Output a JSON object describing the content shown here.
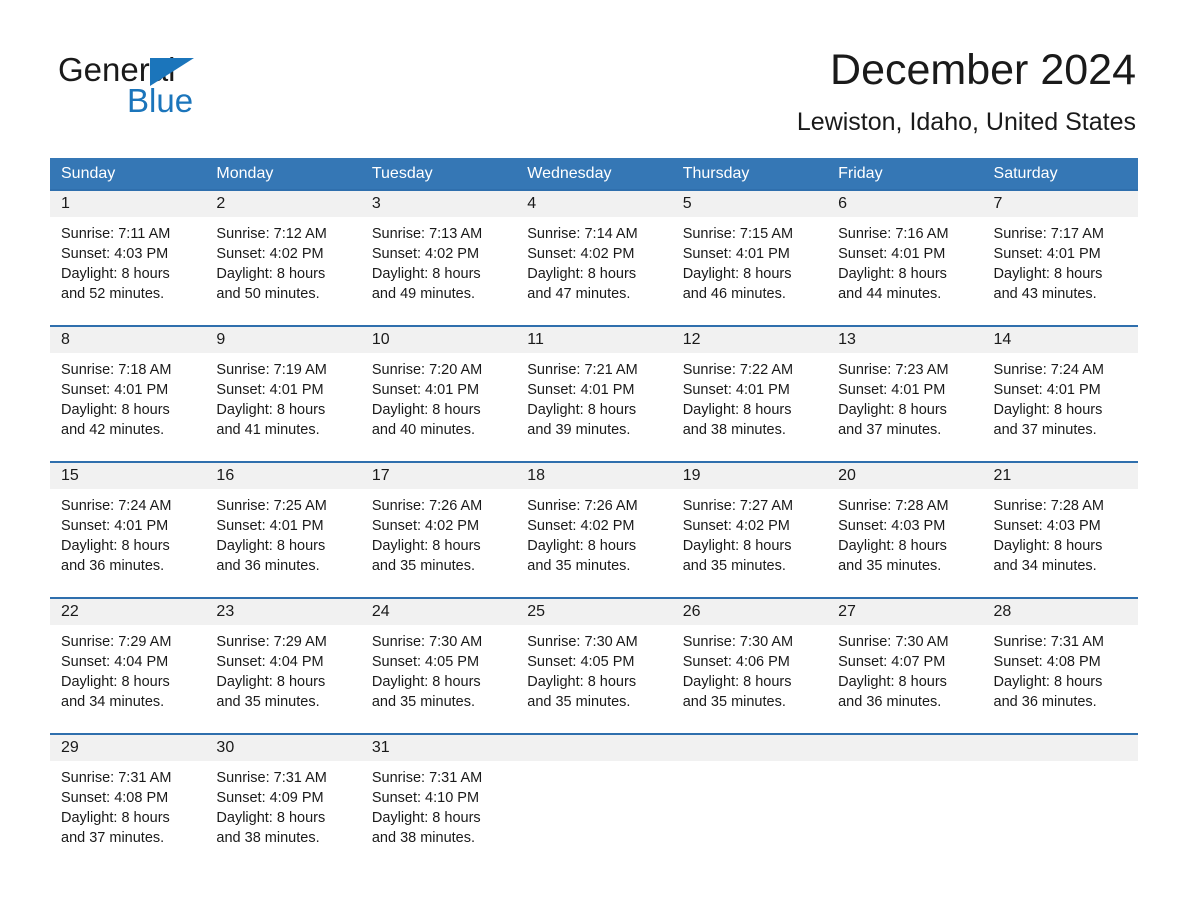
{
  "brand": {
    "name_part1": "General",
    "name_part2": "Blue",
    "accent_color": "#1b75bb"
  },
  "header": {
    "month_title": "December 2024",
    "location": "Lewiston, Idaho, United States"
  },
  "theme": {
    "header_row_bg": "#3577b5",
    "week_rule_color": "#2f6fad",
    "date_band_bg": "#f1f1f1",
    "text_color": "#1a1a1a"
  },
  "weekdays": [
    "Sunday",
    "Monday",
    "Tuesday",
    "Wednesday",
    "Thursday",
    "Friday",
    "Saturday"
  ],
  "weeks": [
    {
      "days": [
        {
          "date": "1",
          "sunrise": "Sunrise: 7:11 AM",
          "sunset": "Sunset: 4:03 PM",
          "daylight_line1": "Daylight: 8 hours",
          "daylight_line2": "and 52 minutes."
        },
        {
          "date": "2",
          "sunrise": "Sunrise: 7:12 AM",
          "sunset": "Sunset: 4:02 PM",
          "daylight_line1": "Daylight: 8 hours",
          "daylight_line2": "and 50 minutes."
        },
        {
          "date": "3",
          "sunrise": "Sunrise: 7:13 AM",
          "sunset": "Sunset: 4:02 PM",
          "daylight_line1": "Daylight: 8 hours",
          "daylight_line2": "and 49 minutes."
        },
        {
          "date": "4",
          "sunrise": "Sunrise: 7:14 AM",
          "sunset": "Sunset: 4:02 PM",
          "daylight_line1": "Daylight: 8 hours",
          "daylight_line2": "and 47 minutes."
        },
        {
          "date": "5",
          "sunrise": "Sunrise: 7:15 AM",
          "sunset": "Sunset: 4:01 PM",
          "daylight_line1": "Daylight: 8 hours",
          "daylight_line2": "and 46 minutes."
        },
        {
          "date": "6",
          "sunrise": "Sunrise: 7:16 AM",
          "sunset": "Sunset: 4:01 PM",
          "daylight_line1": "Daylight: 8 hours",
          "daylight_line2": "and 44 minutes."
        },
        {
          "date": "7",
          "sunrise": "Sunrise: 7:17 AM",
          "sunset": "Sunset: 4:01 PM",
          "daylight_line1": "Daylight: 8 hours",
          "daylight_line2": "and 43 minutes."
        }
      ]
    },
    {
      "days": [
        {
          "date": "8",
          "sunrise": "Sunrise: 7:18 AM",
          "sunset": "Sunset: 4:01 PM",
          "daylight_line1": "Daylight: 8 hours",
          "daylight_line2": "and 42 minutes."
        },
        {
          "date": "9",
          "sunrise": "Sunrise: 7:19 AM",
          "sunset": "Sunset: 4:01 PM",
          "daylight_line1": "Daylight: 8 hours",
          "daylight_line2": "and 41 minutes."
        },
        {
          "date": "10",
          "sunrise": "Sunrise: 7:20 AM",
          "sunset": "Sunset: 4:01 PM",
          "daylight_line1": "Daylight: 8 hours",
          "daylight_line2": "and 40 minutes."
        },
        {
          "date": "11",
          "sunrise": "Sunrise: 7:21 AM",
          "sunset": "Sunset: 4:01 PM",
          "daylight_line1": "Daylight: 8 hours",
          "daylight_line2": "and 39 minutes."
        },
        {
          "date": "12",
          "sunrise": "Sunrise: 7:22 AM",
          "sunset": "Sunset: 4:01 PM",
          "daylight_line1": "Daylight: 8 hours",
          "daylight_line2": "and 38 minutes."
        },
        {
          "date": "13",
          "sunrise": "Sunrise: 7:23 AM",
          "sunset": "Sunset: 4:01 PM",
          "daylight_line1": "Daylight: 8 hours",
          "daylight_line2": "and 37 minutes."
        },
        {
          "date": "14",
          "sunrise": "Sunrise: 7:24 AM",
          "sunset": "Sunset: 4:01 PM",
          "daylight_line1": "Daylight: 8 hours",
          "daylight_line2": "and 37 minutes."
        }
      ]
    },
    {
      "days": [
        {
          "date": "15",
          "sunrise": "Sunrise: 7:24 AM",
          "sunset": "Sunset: 4:01 PM",
          "daylight_line1": "Daylight: 8 hours",
          "daylight_line2": "and 36 minutes."
        },
        {
          "date": "16",
          "sunrise": "Sunrise: 7:25 AM",
          "sunset": "Sunset: 4:01 PM",
          "daylight_line1": "Daylight: 8 hours",
          "daylight_line2": "and 36 minutes."
        },
        {
          "date": "17",
          "sunrise": "Sunrise: 7:26 AM",
          "sunset": "Sunset: 4:02 PM",
          "daylight_line1": "Daylight: 8 hours",
          "daylight_line2": "and 35 minutes."
        },
        {
          "date": "18",
          "sunrise": "Sunrise: 7:26 AM",
          "sunset": "Sunset: 4:02 PM",
          "daylight_line1": "Daylight: 8 hours",
          "daylight_line2": "and 35 minutes."
        },
        {
          "date": "19",
          "sunrise": "Sunrise: 7:27 AM",
          "sunset": "Sunset: 4:02 PM",
          "daylight_line1": "Daylight: 8 hours",
          "daylight_line2": "and 35 minutes."
        },
        {
          "date": "20",
          "sunrise": "Sunrise: 7:28 AM",
          "sunset": "Sunset: 4:03 PM",
          "daylight_line1": "Daylight: 8 hours",
          "daylight_line2": "and 35 minutes."
        },
        {
          "date": "21",
          "sunrise": "Sunrise: 7:28 AM",
          "sunset": "Sunset: 4:03 PM",
          "daylight_line1": "Daylight: 8 hours",
          "daylight_line2": "and 34 minutes."
        }
      ]
    },
    {
      "days": [
        {
          "date": "22",
          "sunrise": "Sunrise: 7:29 AM",
          "sunset": "Sunset: 4:04 PM",
          "daylight_line1": "Daylight: 8 hours",
          "daylight_line2": "and 34 minutes."
        },
        {
          "date": "23",
          "sunrise": "Sunrise: 7:29 AM",
          "sunset": "Sunset: 4:04 PM",
          "daylight_line1": "Daylight: 8 hours",
          "daylight_line2": "and 35 minutes."
        },
        {
          "date": "24",
          "sunrise": "Sunrise: 7:30 AM",
          "sunset": "Sunset: 4:05 PM",
          "daylight_line1": "Daylight: 8 hours",
          "daylight_line2": "and 35 minutes."
        },
        {
          "date": "25",
          "sunrise": "Sunrise: 7:30 AM",
          "sunset": "Sunset: 4:05 PM",
          "daylight_line1": "Daylight: 8 hours",
          "daylight_line2": "and 35 minutes."
        },
        {
          "date": "26",
          "sunrise": "Sunrise: 7:30 AM",
          "sunset": "Sunset: 4:06 PM",
          "daylight_line1": "Daylight: 8 hours",
          "daylight_line2": "and 35 minutes."
        },
        {
          "date": "27",
          "sunrise": "Sunrise: 7:30 AM",
          "sunset": "Sunset: 4:07 PM",
          "daylight_line1": "Daylight: 8 hours",
          "daylight_line2": "and 36 minutes."
        },
        {
          "date": "28",
          "sunrise": "Sunrise: 7:31 AM",
          "sunset": "Sunset: 4:08 PM",
          "daylight_line1": "Daylight: 8 hours",
          "daylight_line2": "and 36 minutes."
        }
      ]
    },
    {
      "days": [
        {
          "date": "29",
          "sunrise": "Sunrise: 7:31 AM",
          "sunset": "Sunset: 4:08 PM",
          "daylight_line1": "Daylight: 8 hours",
          "daylight_line2": "and 37 minutes."
        },
        {
          "date": "30",
          "sunrise": "Sunrise: 7:31 AM",
          "sunset": "Sunset: 4:09 PM",
          "daylight_line1": "Daylight: 8 hours",
          "daylight_line2": "and 38 minutes."
        },
        {
          "date": "31",
          "sunrise": "Sunrise: 7:31 AM",
          "sunset": "Sunset: 4:10 PM",
          "daylight_line1": "Daylight: 8 hours",
          "daylight_line2": "and 38 minutes."
        },
        {
          "date": "",
          "sunrise": "",
          "sunset": "",
          "daylight_line1": "",
          "daylight_line2": ""
        },
        {
          "date": "",
          "sunrise": "",
          "sunset": "",
          "daylight_line1": "",
          "daylight_line2": ""
        },
        {
          "date": "",
          "sunrise": "",
          "sunset": "",
          "daylight_line1": "",
          "daylight_line2": ""
        },
        {
          "date": "",
          "sunrise": "",
          "sunset": "",
          "daylight_line1": "",
          "daylight_line2": ""
        }
      ]
    }
  ]
}
